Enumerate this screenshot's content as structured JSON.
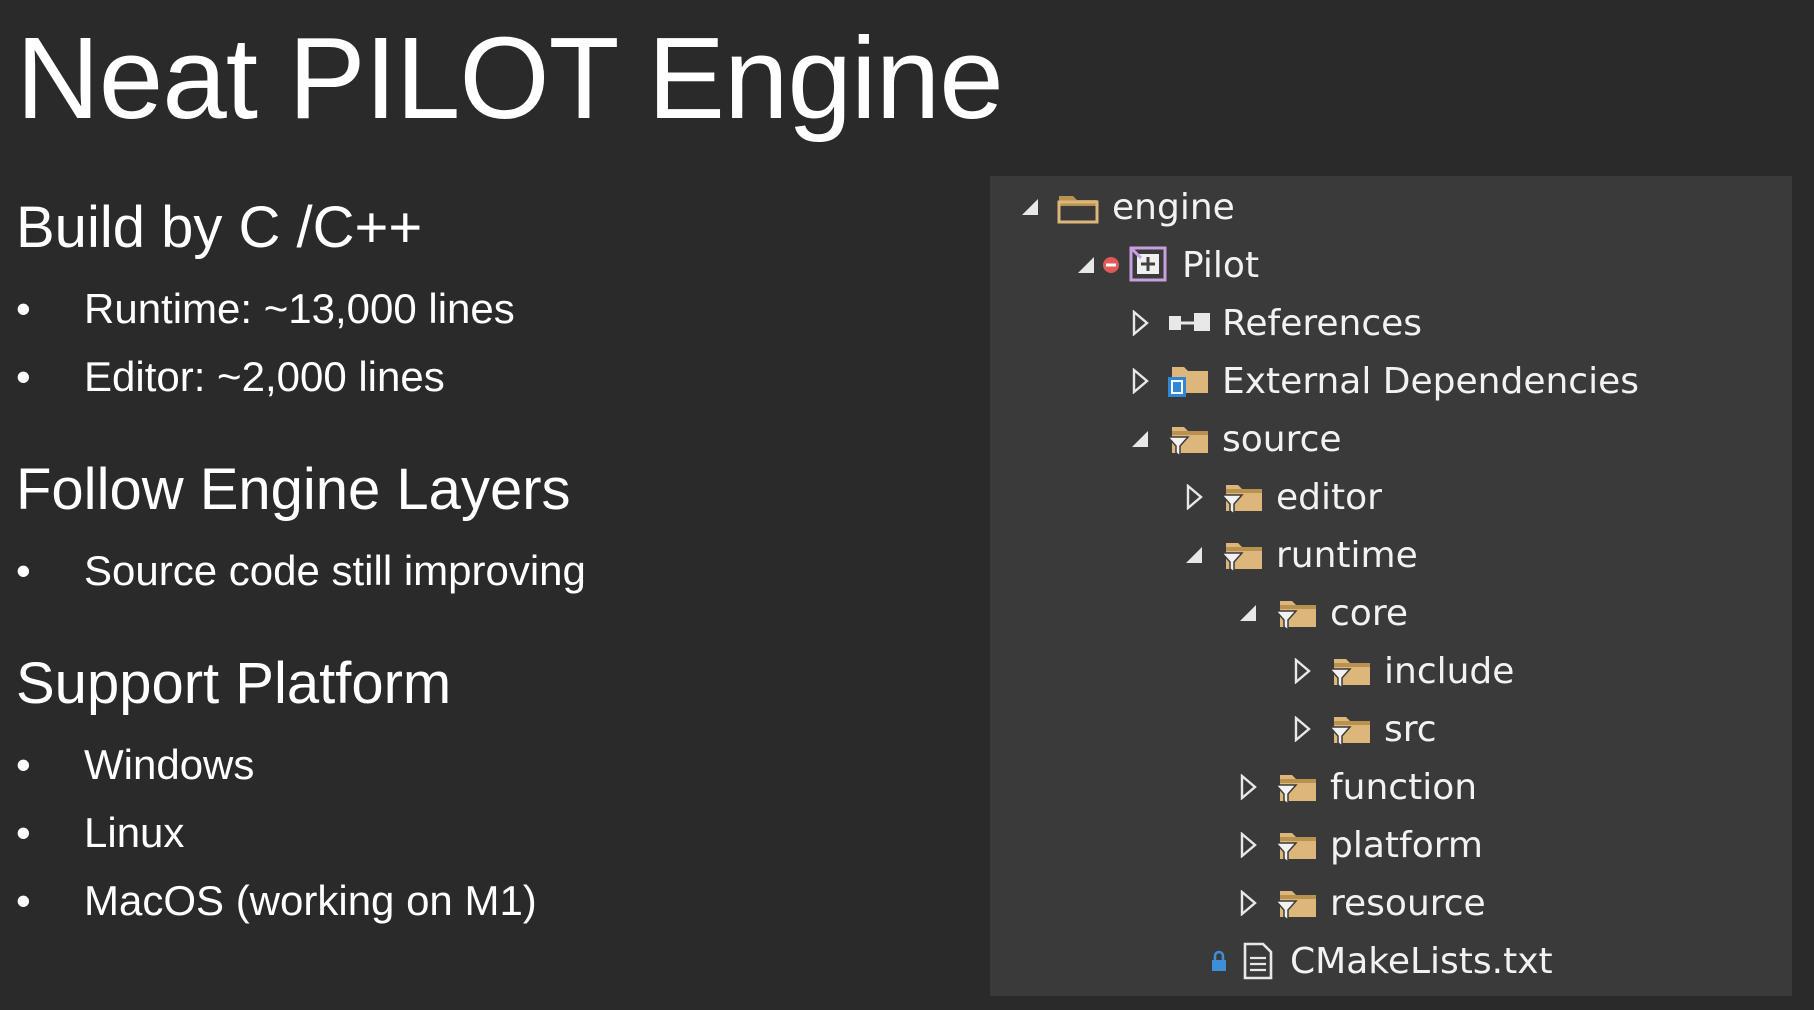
{
  "title": "Neat PILOT Engine",
  "sections": [
    {
      "heading": "Build by C /C++",
      "bullets": [
        "Runtime: ~13,000 lines",
        "Editor: ~2,000 lines"
      ]
    },
    {
      "heading": "Follow Engine Layers",
      "bullets": [
        "Source code still improving"
      ]
    },
    {
      "heading": "Support Platform",
      "bullets": [
        "Windows",
        "Linux",
        "MacOS (working on M1)"
      ]
    }
  ],
  "bullet_glyph": "•",
  "tree": {
    "items": [
      {
        "label": "engine",
        "state": "expanded",
        "icon": "folder-open-icon"
      },
      {
        "label": "Pilot",
        "state": "expanded",
        "icon": "project-icon",
        "status_icon": "error-icon"
      },
      {
        "label": "References",
        "state": "collapsed",
        "icon": "references-icon"
      },
      {
        "label": "External Dependencies",
        "state": "collapsed",
        "icon": "external-dependencies-icon"
      },
      {
        "label": "source",
        "state": "expanded",
        "icon": "filter-folder-icon"
      },
      {
        "label": "editor",
        "state": "collapsed",
        "icon": "filter-folder-icon"
      },
      {
        "label": "runtime",
        "state": "expanded",
        "icon": "filter-folder-icon"
      },
      {
        "label": "core",
        "state": "expanded",
        "icon": "filter-folder-icon"
      },
      {
        "label": "include",
        "state": "collapsed",
        "icon": "filter-folder-icon"
      },
      {
        "label": "src",
        "state": "collapsed",
        "icon": "filter-folder-icon"
      },
      {
        "label": "function",
        "state": "collapsed",
        "icon": "filter-folder-icon"
      },
      {
        "label": "platform",
        "state": "collapsed",
        "icon": "filter-folder-icon"
      },
      {
        "label": "resource",
        "state": "collapsed",
        "icon": "filter-folder-icon"
      },
      {
        "label": "CMakeLists.txt",
        "state": "leaf",
        "icon": "text-file-icon",
        "status_icon": "lock-icon"
      }
    ]
  },
  "colors": {
    "background": "#2a2a2a",
    "panel": "#3a3a3a",
    "text": "#ffffff",
    "folder": "#dcb67a",
    "folder_dark": "#b8924e",
    "error": "#e05a5a",
    "lock": "#3f8fd8",
    "project_border": "#c8a0e0"
  }
}
